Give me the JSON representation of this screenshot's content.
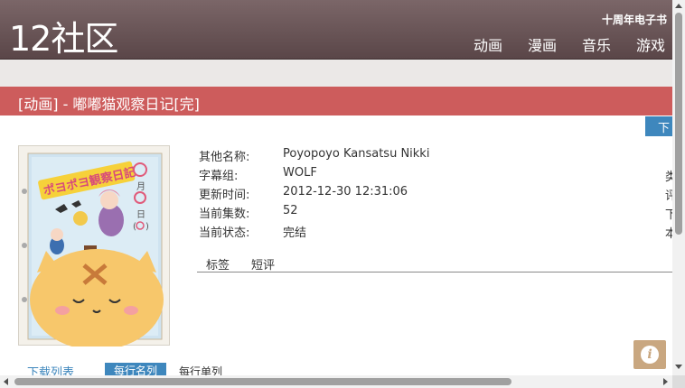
{
  "header": {
    "logo": "12社区",
    "ebook_link": "十周年电子书",
    "nav": [
      "动画",
      "漫画",
      "音乐",
      "游戏"
    ]
  },
  "title_bar": {
    "title": "[动画] - 嘟嘟猫观察日记[完]"
  },
  "download_button": {
    "label": "下"
  },
  "info": {
    "rows": [
      {
        "label": "其他名称:",
        "value": "Poyopoyo Kansatsu Nikki",
        "edge": "类"
      },
      {
        "label": "字幕组:",
        "value": "WOLF",
        "edge": "评"
      },
      {
        "label": "更新时间:",
        "value": "2012-12-30 12:31:06",
        "edge": "下"
      },
      {
        "label": "当前集数:",
        "value": "52",
        "edge": "本"
      },
      {
        "label": "当前状态:",
        "value": "完结",
        "edge": ""
      }
    ]
  },
  "tabs": [
    "标签",
    "短评"
  ],
  "bottom": {
    "download_list": "下载列表",
    "per_row_name": "每行名列",
    "per_row_single": "每行单列"
  },
  "poster": {
    "title_text": "ポヨポヨ観察日記",
    "date_marks": [
      "月",
      "日",
      "(",
      ")"
    ]
  },
  "colors": {
    "header": "#6b5658",
    "title_bar": "#cd5c5c",
    "accent_blue": "#3e87bd",
    "info_button": "#c9a780"
  },
  "icons": {
    "info_button": "info-icon"
  }
}
